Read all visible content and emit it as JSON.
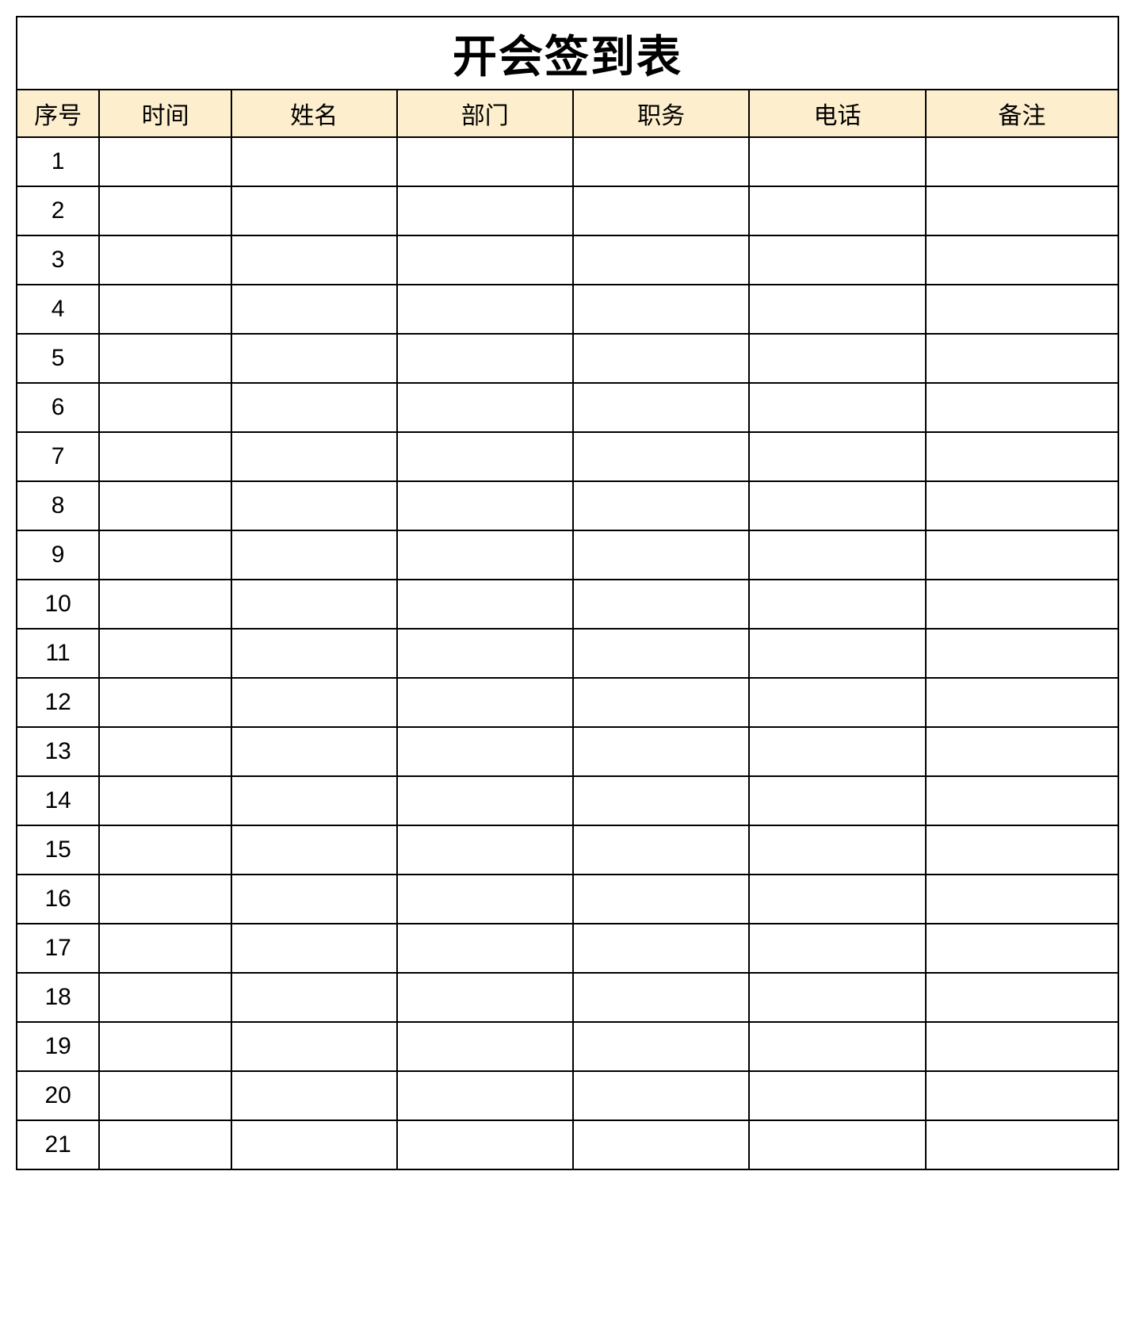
{
  "title": "开会签到表",
  "columns": {
    "serial": "序号",
    "time": "时间",
    "name": "姓名",
    "department": "部门",
    "position": "职务",
    "phone": "电话",
    "note": "备注"
  },
  "rows": [
    {
      "serial": "1",
      "time": "",
      "name": "",
      "department": "",
      "position": "",
      "phone": "",
      "note": ""
    },
    {
      "serial": "2",
      "time": "",
      "name": "",
      "department": "",
      "position": "",
      "phone": "",
      "note": ""
    },
    {
      "serial": "3",
      "time": "",
      "name": "",
      "department": "",
      "position": "",
      "phone": "",
      "note": ""
    },
    {
      "serial": "4",
      "time": "",
      "name": "",
      "department": "",
      "position": "",
      "phone": "",
      "note": ""
    },
    {
      "serial": "5",
      "time": "",
      "name": "",
      "department": "",
      "position": "",
      "phone": "",
      "note": ""
    },
    {
      "serial": "6",
      "time": "",
      "name": "",
      "department": "",
      "position": "",
      "phone": "",
      "note": ""
    },
    {
      "serial": "7",
      "time": "",
      "name": "",
      "department": "",
      "position": "",
      "phone": "",
      "note": ""
    },
    {
      "serial": "8",
      "time": "",
      "name": "",
      "department": "",
      "position": "",
      "phone": "",
      "note": ""
    },
    {
      "serial": "9",
      "time": "",
      "name": "",
      "department": "",
      "position": "",
      "phone": "",
      "note": ""
    },
    {
      "serial": "10",
      "time": "",
      "name": "",
      "department": "",
      "position": "",
      "phone": "",
      "note": ""
    },
    {
      "serial": "11",
      "time": "",
      "name": "",
      "department": "",
      "position": "",
      "phone": "",
      "note": ""
    },
    {
      "serial": "12",
      "time": "",
      "name": "",
      "department": "",
      "position": "",
      "phone": "",
      "note": ""
    },
    {
      "serial": "13",
      "time": "",
      "name": "",
      "department": "",
      "position": "",
      "phone": "",
      "note": ""
    },
    {
      "serial": "14",
      "time": "",
      "name": "",
      "department": "",
      "position": "",
      "phone": "",
      "note": ""
    },
    {
      "serial": "15",
      "time": "",
      "name": "",
      "department": "",
      "position": "",
      "phone": "",
      "note": ""
    },
    {
      "serial": "16",
      "time": "",
      "name": "",
      "department": "",
      "position": "",
      "phone": "",
      "note": ""
    },
    {
      "serial": "17",
      "time": "",
      "name": "",
      "department": "",
      "position": "",
      "phone": "",
      "note": ""
    },
    {
      "serial": "18",
      "time": "",
      "name": "",
      "department": "",
      "position": "",
      "phone": "",
      "note": ""
    },
    {
      "serial": "19",
      "time": "",
      "name": "",
      "department": "",
      "position": "",
      "phone": "",
      "note": ""
    },
    {
      "serial": "20",
      "time": "",
      "name": "",
      "department": "",
      "position": "",
      "phone": "",
      "note": ""
    },
    {
      "serial": "21",
      "time": "",
      "name": "",
      "department": "",
      "position": "",
      "phone": "",
      "note": ""
    }
  ]
}
